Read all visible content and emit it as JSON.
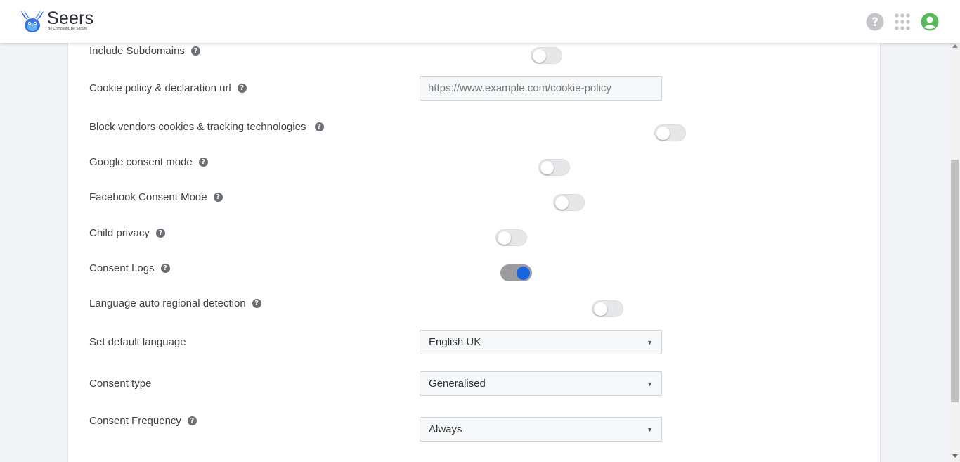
{
  "brand": {
    "name": "Seers",
    "tagline": "Be Compliant, Be Secure"
  },
  "colors": {
    "accent": "#1a66e0",
    "avatar": "#5cb85c"
  },
  "header_icons": [
    "help-circle-icon",
    "apps-grid-icon",
    "user-avatar-icon"
  ],
  "settings": {
    "include_subdomains": {
      "label": "Include Subdomains",
      "enabled": false
    },
    "cookie_policy_url": {
      "label": "Cookie policy & declaration url",
      "placeholder": "https://www.example.com/cookie-policy"
    },
    "block_vendors": {
      "label": "Block vendors cookies & tracking technologies",
      "enabled": false
    },
    "google_consent": {
      "label": "Google consent mode",
      "enabled": false
    },
    "facebook_consent": {
      "label": "Facebook Consent Mode",
      "enabled": false
    },
    "child_privacy": {
      "label": "Child privacy",
      "enabled": false
    },
    "consent_logs": {
      "label": "Consent Logs",
      "enabled": true
    },
    "language_detection": {
      "label": "Language auto regional detection",
      "enabled": false
    },
    "default_language": {
      "label": "Set default language",
      "value": "English UK"
    },
    "consent_type": {
      "label": "Consent type",
      "value": "Generalised"
    },
    "consent_frequency": {
      "label": "Consent Frequency",
      "value": "Always"
    }
  }
}
